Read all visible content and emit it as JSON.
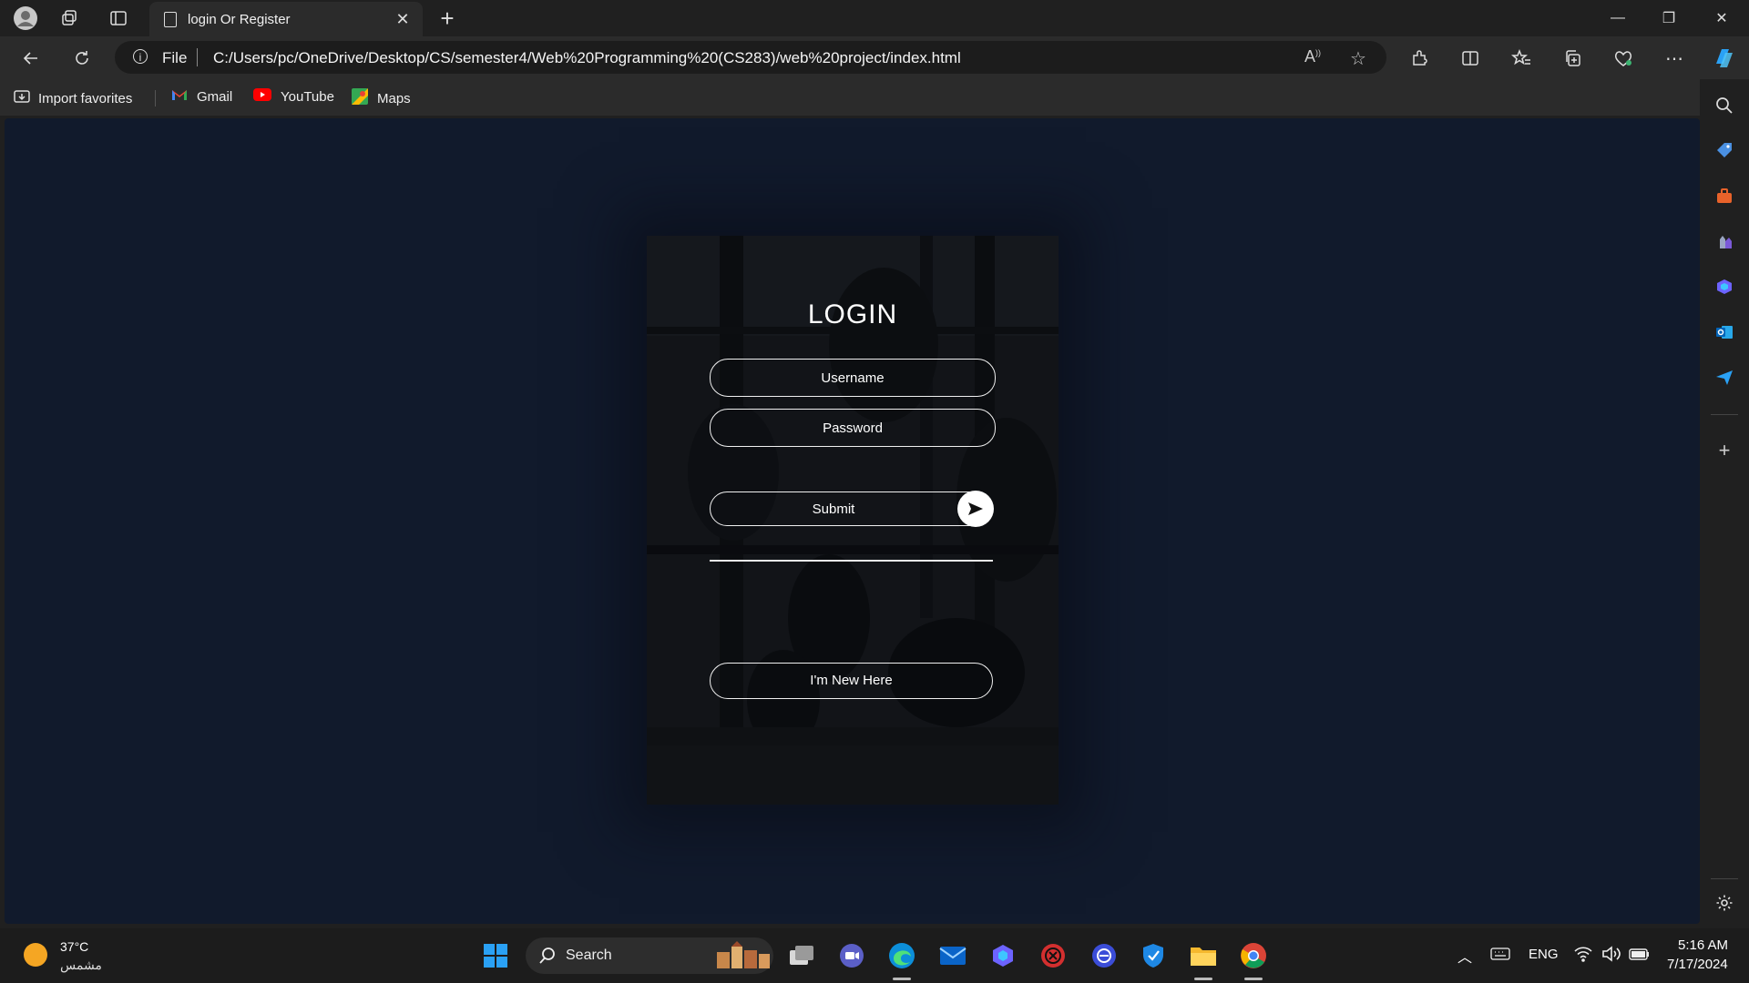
{
  "browser": {
    "tab_title": "login Or Register",
    "address": {
      "scheme_label": "File",
      "url": "C:/Users/pc/OneDrive/Desktop/CS/semester4/Web%20Programming%20(CS283)/web%20project/index.html"
    },
    "favorites": [
      {
        "label": "Import favorites",
        "icon": "import-icon"
      },
      {
        "label": "Gmail",
        "icon": "gmail-icon"
      },
      {
        "label": "YouTube",
        "icon": "youtube-icon"
      },
      {
        "label": "Maps",
        "icon": "maps-icon"
      }
    ]
  },
  "page": {
    "heading": "LOGIN",
    "username_placeholder": "Username",
    "password_placeholder": "Password",
    "submit_label": "Submit",
    "new_here_label": "I'm New Here",
    "background": "#111a2c"
  },
  "taskbar": {
    "weather_temp": "37°C",
    "weather_desc": "مشمس",
    "search_label": "Search",
    "lang": "ENG",
    "time": "5:16 AM",
    "date": "7/17/2024"
  },
  "colors": {
    "accent_edge": "#3b82f6",
    "windows_blue": "#2aa1f5"
  }
}
